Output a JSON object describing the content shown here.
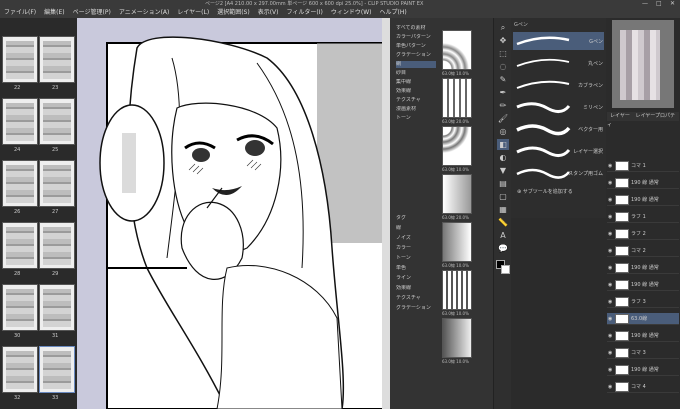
{
  "window": {
    "title": "ページ2 [A4 210.00 x 297.00mm 単ページ 600 x 600 dpi 25.0%] - CLIP STUDIO PAINT EX",
    "controls": [
      "—",
      "□",
      "✕"
    ]
  },
  "menu": [
    "ファイル(F)",
    "編集(E)",
    "ページ管理(P)",
    "アニメーション(A)",
    "レイヤー(L)",
    "選択範囲(S)",
    "表示(V)",
    "フィルター(I)",
    "ウィンドウ(W)",
    "ヘルプ(H)"
  ],
  "page_numbers": [
    "22",
    "23",
    "24",
    "25",
    "26",
    "27",
    "28",
    "29",
    "30",
    "31",
    "32",
    "33"
  ],
  "material_tree": [
    "すべての素材",
    "カラーパターン",
    "単色パターン",
    "グラデーション",
    "網",
    "砂目",
    "集中線",
    "効果線",
    "テクスチャ",
    "漫画素材",
    "トーン"
  ],
  "material_labels": [
    "63.0線 10.0%",
    "63.0線 20.0%",
    "63.0線 10.0%",
    "63.0線 20.0%",
    "63.0線 10.0%",
    "63.0線 10.0%",
    "63.0線 10.0%",
    "63.0線 20.0%"
  ],
  "material_props": [
    "タグ",
    "線",
    "ノイズ",
    "カラー",
    "トーン",
    "単色",
    "ライン",
    "効果線",
    "テクスチャ",
    "グラデーション"
  ],
  "brushes": {
    "title": "Gペン",
    "items": [
      "Gペン",
      "丸ペン",
      "カブラペン",
      "ミリペン",
      "ベクター用",
      "レイヤー選択",
      "スタンプ用ゴム"
    ],
    "add_label": "サブツールを追加する"
  },
  "layer_tabs": [
    "レイヤー",
    "レイヤープロパティ"
  ],
  "layers": [
    {
      "name": "コマ 1",
      "sel": false
    },
    {
      "name": "190 線 通常",
      "sel": false
    },
    {
      "name": "190 線 通常",
      "sel": false
    },
    {
      "name": "ラフ 1",
      "sel": false
    },
    {
      "name": "ラフ 2",
      "sel": false
    },
    {
      "name": "コマ 2",
      "sel": false
    },
    {
      "name": "190 線 通常",
      "sel": false
    },
    {
      "name": "190 線 通常",
      "sel": false
    },
    {
      "name": "ラフ 3",
      "sel": false
    },
    {
      "name": "63.0線",
      "sel": true
    },
    {
      "name": "190 線 通常",
      "sel": false
    },
    {
      "name": "コマ 3",
      "sel": false
    },
    {
      "name": "190 線 通常",
      "sel": false
    },
    {
      "name": "コマ 4",
      "sel": false
    }
  ]
}
